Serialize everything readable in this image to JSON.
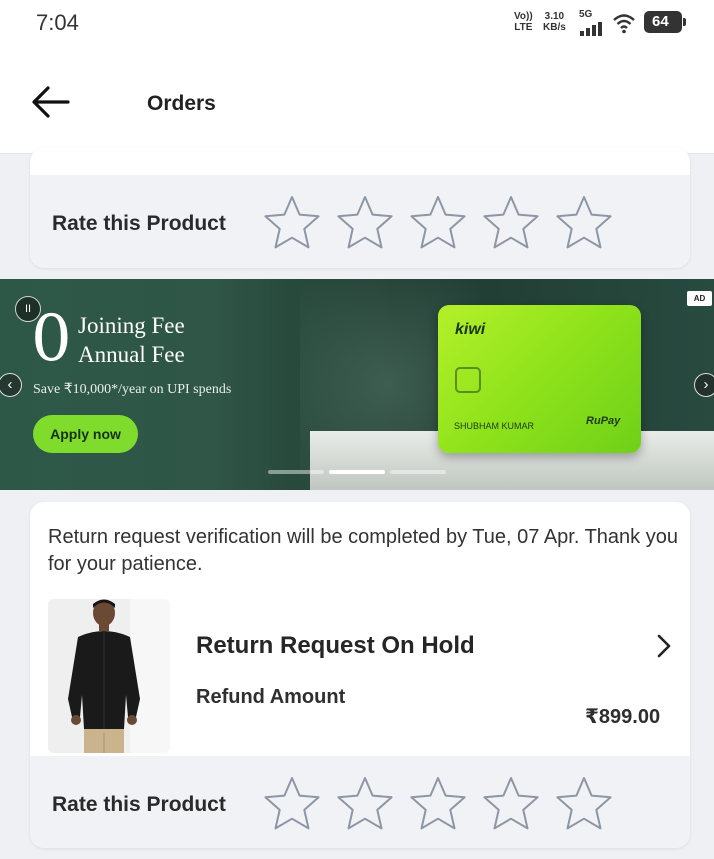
{
  "status_bar": {
    "time": "7:04",
    "network_top": "Vo))",
    "network_bottom": "LTE",
    "speed_value": "3.10",
    "speed_unit": "KB/s",
    "generation": "5G",
    "battery": "64"
  },
  "header": {
    "title": "Orders",
    "back_icon": "arrow-left-icon"
  },
  "rating_top": {
    "label": "Rate this Product",
    "stars": 5,
    "rating": 0
  },
  "banner": {
    "zero": "0",
    "line1": "Joining Fee",
    "line2": "Annual Fee",
    "savings": "Save ₹10,000*/year on UPI spends",
    "cta": "Apply now",
    "ad_label": "AD",
    "card_brand": "kiwi",
    "card_holder": "SHUBHAM KUMAR",
    "card_network": "RuPay",
    "slides": 3,
    "active_slide": 1,
    "colors": {
      "card": "#9be624",
      "cta": "#7fdc2c"
    }
  },
  "order": {
    "message": "Return request verification will be completed by Tue, 07 Apr. Thank you for your patience.",
    "status": "Return Request On Hold",
    "refund_label": "Refund Amount",
    "refund_amount": "₹899.00",
    "image": "man-in-black-shirt"
  },
  "rating_bottom": {
    "label": "Rate this Product",
    "stars": 5,
    "rating": 0
  }
}
